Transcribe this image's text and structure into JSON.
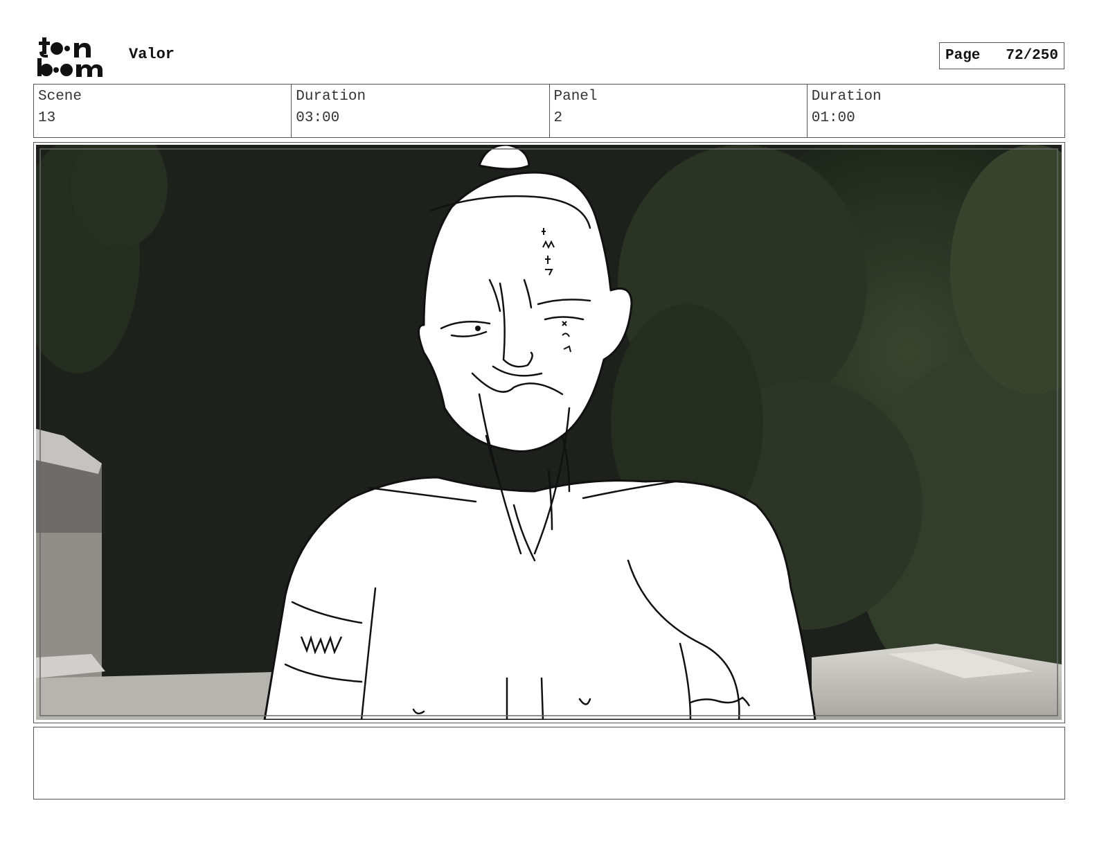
{
  "header": {
    "logo_text": "toon boom",
    "project_title": "Valor",
    "page_label": "Page",
    "page_number": "72/250"
  },
  "info": {
    "scene_label": "Scene",
    "scene_value": "13",
    "scene_duration_label": "Duration",
    "scene_duration_value": "03:00",
    "panel_label": "Panel",
    "panel_value": "2",
    "panel_duration_label": "Duration",
    "panel_duration_value": "01:00"
  },
  "colors": {
    "border": "#555555",
    "background_dark": "#1e211c",
    "foliage": "#2f3a28",
    "roof": "#c9c7c2"
  },
  "notes": {
    "text": ""
  }
}
